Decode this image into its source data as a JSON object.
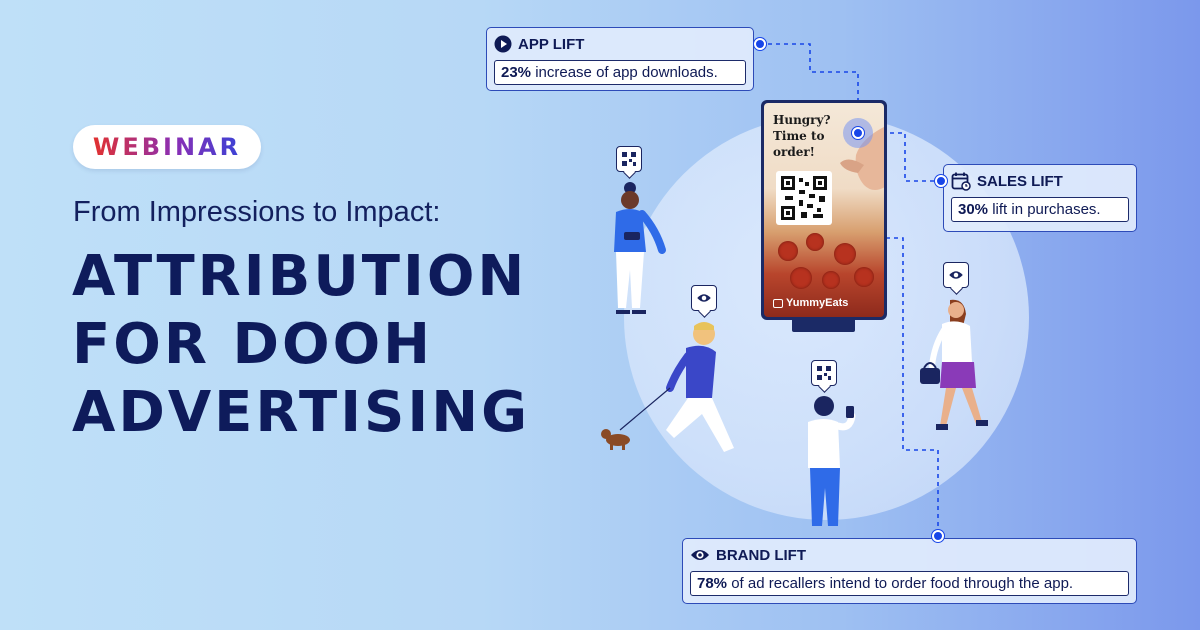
{
  "badge": {
    "label": "WEBINAR"
  },
  "subtitle": "From Impressions to Impact:",
  "headline": {
    "line1": "ATTRIBUTION",
    "line2": "FOR DOOH",
    "line3": "ADVERTISING"
  },
  "billboard": {
    "line1": "Hungry?",
    "line2": "Time to",
    "line3": "order!",
    "brand": "YummyEats"
  },
  "callouts": {
    "app_lift": {
      "title": "APP LIFT",
      "icon": "play-icon",
      "highlight": "23%",
      "text": " increase of app downloads."
    },
    "sales_lift": {
      "title": "SALES LIFT",
      "icon": "calendar-icon",
      "highlight": "30%",
      "text": " lift in purchases."
    },
    "brand_lift": {
      "title": "BRAND LIFT",
      "icon": "eye-icon",
      "highlight": "78%",
      "text": " of ad recallers intend to order food through the app."
    }
  },
  "colors": {
    "navy": "#0e1b5b",
    "accent_blue": "#1846e8",
    "badge_red": "#e2312f",
    "badge_purple": "#8a2fb5",
    "badge_blue": "#3a42d6"
  }
}
